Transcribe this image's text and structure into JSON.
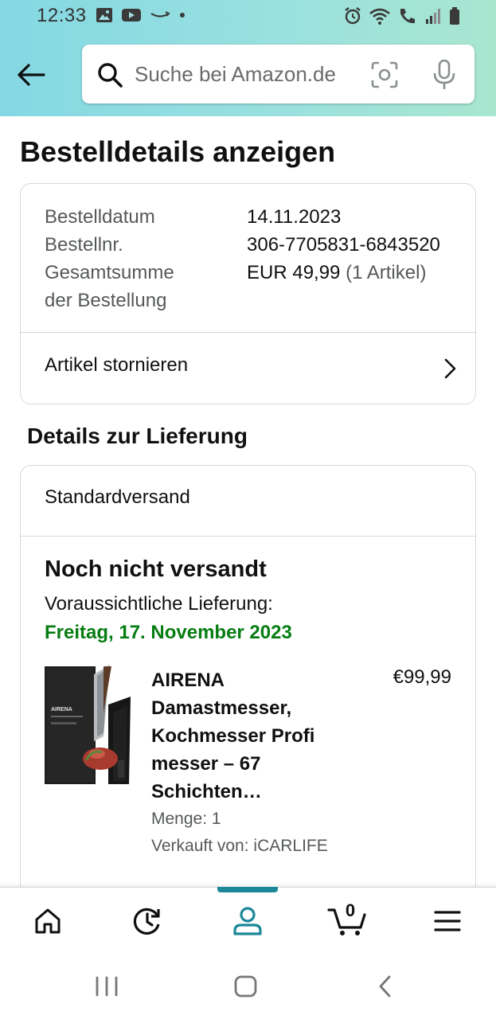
{
  "status_bar": {
    "time": "12:33"
  },
  "header": {
    "search_placeholder": "Suche bei Amazon.de"
  },
  "page": {
    "title": "Bestelldetails anzeigen"
  },
  "order_summary": {
    "date_label": "Bestelldatum",
    "date_value": "14.11.2023",
    "number_label": "Bestellnr.",
    "number_value": "306-7705831-6843520",
    "total_label_line1": "Gesamtsumme",
    "total_label_line2": "der Bestellung",
    "total_value": "EUR 49,99",
    "total_items": "(1 Artikel)",
    "cancel_label": "Artikel stornieren"
  },
  "delivery": {
    "section_title": "Details zur Lieferung",
    "shipping_method": "Standardversand",
    "status": "Noch nicht versandt",
    "eta_label": "Voraussichtliche Lieferung:",
    "eta_date": "Freitag, 17. November 2023",
    "eta_color": "#067d12",
    "item": {
      "title": "AIRENA Damastmesser, Kochmesser Profi messer – 67 Schichten…",
      "price": "€99,99",
      "quantity": "Menge: 1",
      "seller": "Verkauft von: iCARLIFE",
      "thumb_brand": "AIRENA"
    }
  },
  "bottom_nav": {
    "items": [
      "home-icon",
      "history-icon",
      "account-icon",
      "cart-icon",
      "menu-icon"
    ],
    "active": "account-icon",
    "active_color": "#1b8798",
    "cart_count": "0"
  }
}
